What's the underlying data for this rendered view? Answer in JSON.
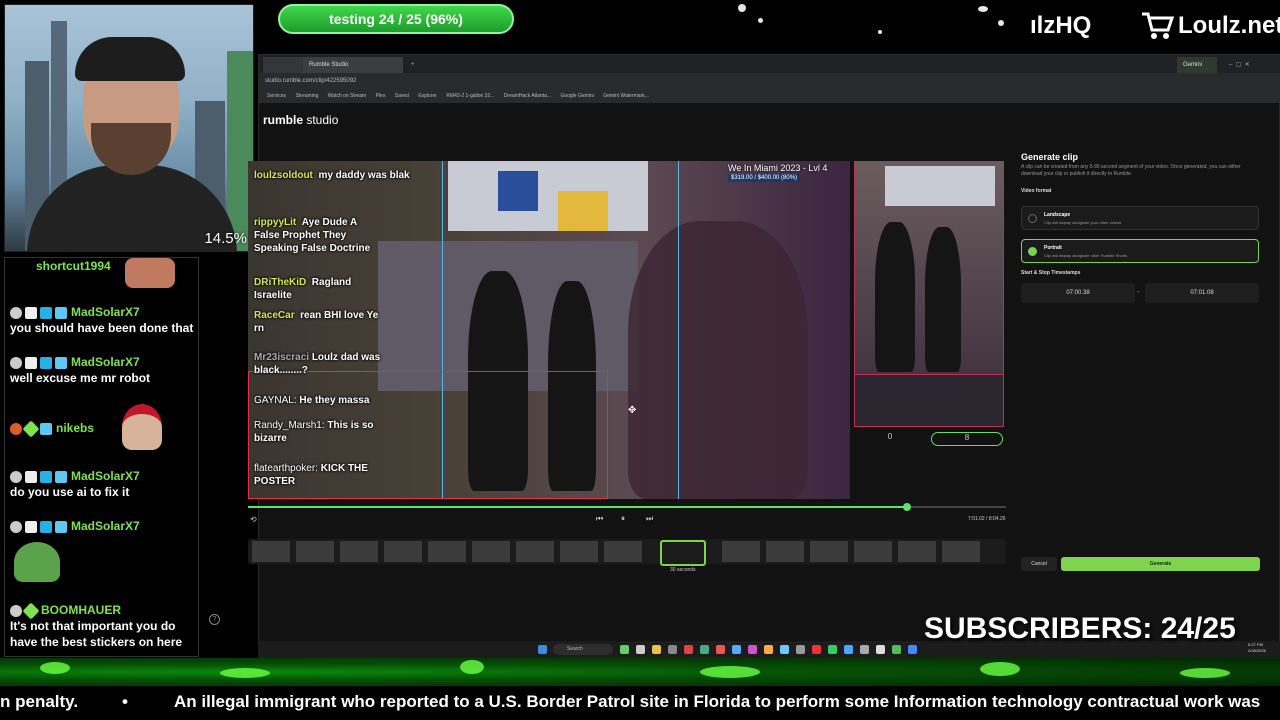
{
  "overlay": {
    "progress_text": "testing 24 / 25 (96%)",
    "brand_left": "ılzHQ",
    "brand_right": "Loulz.net",
    "webcam_percent": "14.5%",
    "subscribers": "SUBSCRIBERS: 24/25",
    "ticker_a": "n penalty.",
    "ticker_sep": "•",
    "ticker_b": "An illegal immigrant who reported to a U.S. Border Patrol site in Florida to perform some Information technology contractual work was"
  },
  "chat": {
    "messages": [
      {
        "user": "shortcut1994",
        "text": "",
        "color": "#7ee24f"
      },
      {
        "user": "MadSolarX7",
        "text": "you should have been done that",
        "color": "#7ee24f"
      },
      {
        "user": "MadSolarX7",
        "text": "well excuse me mr robot",
        "color": "#7ee24f"
      },
      {
        "user": "nikebs",
        "text": "",
        "color": "#7ee24f"
      },
      {
        "user": "MadSolarX7",
        "text": "do you use ai to fix it",
        "color": "#7ee24f"
      },
      {
        "user": "MadSolarX7",
        "text": "",
        "color": "#7ee24f"
      },
      {
        "user": "BOOMHAUER",
        "text": "It's not that important you do have the best stickers on here",
        "color": "#7ee24f"
      }
    ]
  },
  "browser": {
    "tabs": [
      "Rumble Studio"
    ],
    "url": "studio.rumble.com/clip/422595092",
    "bookmarks": [
      "Services",
      "Streaming",
      "Watch on Stream",
      "Plex",
      "Saved",
      "Explorer",
      "RM43-2 1-gallon 32...",
      "DreamHack Atlanta...",
      "Google Gemini",
      "Gemini Watermark..."
    ],
    "profile_label": "Gemini"
  },
  "studio": {
    "logo_bold": "rumble",
    "logo_rest": " studio",
    "video_title": "We In Miami 2023 - Lvl 4",
    "video_sub": "$319.00 / $400.00 (80%)",
    "chat_overlay": [
      {
        "user": "loulzsoldout",
        "text": "my daddy was blak"
      },
      {
        "user": "rippyyLit",
        "text": "Aye Dude A False Prophet They Speaking False Doctrine"
      },
      {
        "user": "DRiTheKiD",
        "text": "Ragland Israelite"
      },
      {
        "user": "RaceCar",
        "text": "rean BHI love Ye rn"
      },
      {
        "user": "Mr23iscraci",
        "text": "Loulz dad was black........?"
      },
      {
        "user": "GAYNAL:",
        "text": "He they massa"
      },
      {
        "user": "Randy_Marsh1:",
        "text": "This is so bizarre"
      },
      {
        "user": "flatearthpoker:",
        "text": "KICK THE POSTER"
      }
    ],
    "preview_counter_a": "0",
    "preview_counter_b": "8",
    "panel": {
      "title": "Generate clip",
      "description": "A clip can be created from any 5-90 second segment of your video. Once generated, you can either download your clip or publish it directly to Rumble.",
      "format_label": "Video format",
      "options": [
        {
          "title": "Landscape",
          "desc": "Clip will display alongside your other videos",
          "selected": false
        },
        {
          "title": "Portrait",
          "desc": "Clip will display alongside other Rumble Shorts",
          "selected": true
        }
      ],
      "ts_label": "Start & Stop Timestamps",
      "start": "07:00.38",
      "stop": "07:01.08",
      "cancel": "Cancel",
      "generate": "Generate"
    },
    "timeline": {
      "time_readout": "7:01.02 / 8:04.26",
      "clip_length": "30 seconds",
      "progress_fraction": 0.87
    }
  },
  "taskbar": {
    "search": "Search",
    "time": "5:27 PM",
    "date": "2/28/2026"
  },
  "colors": {
    "accent_green": "#7fd34e",
    "crop_red": "#e0304a",
    "guide_blue": "#58b7e6"
  }
}
